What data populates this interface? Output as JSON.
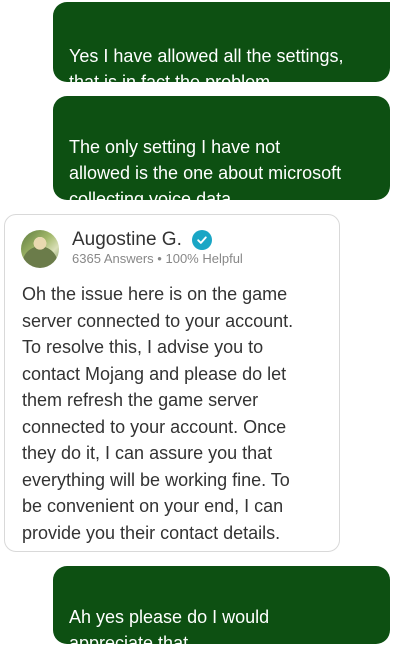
{
  "messages": {
    "user_1": "Yes I have allowed all the settings,\nthat is in fact the problem",
    "user_2": "The only setting I have not\nallowed is the one about microsoft\ncollecting voice data",
    "user_3": "Ah yes please do I would\nappreciate that"
  },
  "agent": {
    "name": "Augostine G.",
    "answers": "6365 Answers",
    "separator": "•",
    "helpful": "100% Helpful",
    "verified_color": "#1aa6c5",
    "message": "Oh the issue here is on the game\nserver connected to your account.\nTo resolve this, I advise you to\ncontact Mojang and please do let\nthem refresh the game server\nconnected to your account. Once\nthey do it, I can assure you that\neverything will be working fine. To\nbe convenient on your end, I can\nprovide you their contact details."
  },
  "colors": {
    "user_bubble": "#0d5012",
    "card_border": "#d9d9d9"
  },
  "icons": {
    "verified": "verified-check-icon",
    "avatar": "expert-avatar"
  }
}
